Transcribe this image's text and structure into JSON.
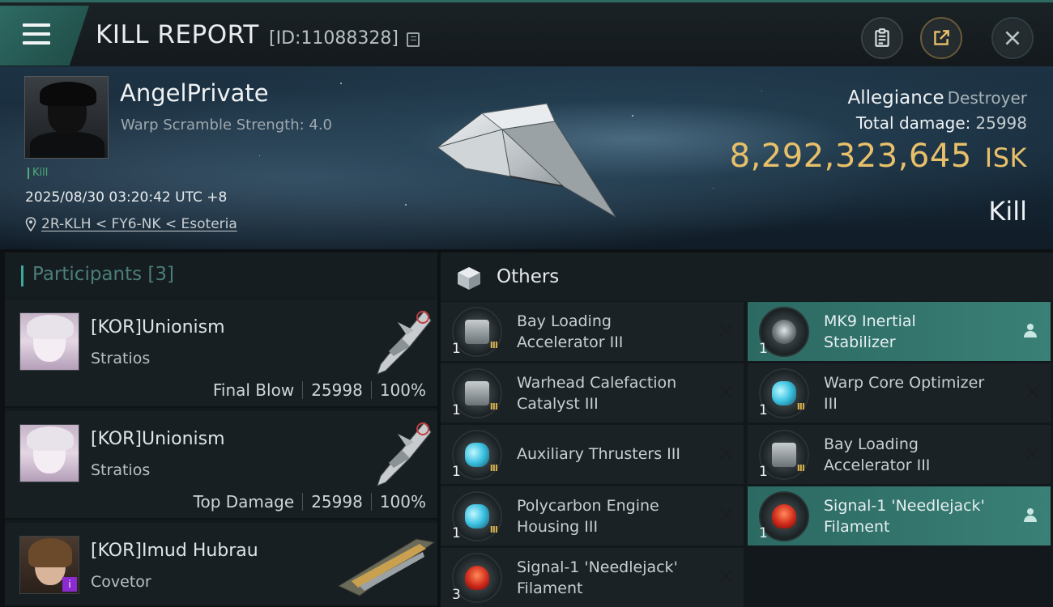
{
  "header": {
    "title": "KILL REPORT",
    "report_id": "[ID:11088328]"
  },
  "victim": {
    "name": "AngelPrivate",
    "warp_scramble": "Warp Scramble Strength: 4.0",
    "kill_tag": "Kill",
    "datetime": "2025/08/30 03:20:42 UTC +8",
    "location": "2R-KLH < FY6-NK < Esoteria",
    "allegiance_label": "Allegiance",
    "ship_class": "Destroyer",
    "total_damage_label": "Total damage:",
    "total_damage": "25998",
    "isk_value": "8,292,323,645",
    "isk_unit": "ISK",
    "result": "Kill"
  },
  "participants": {
    "title": "Participants",
    "count": "[3]",
    "rows": [
      {
        "name": "[KOR]Unionism",
        "ship": "Stratios",
        "role": "Final Blow",
        "damage": "25998",
        "percent": "100%"
      },
      {
        "name": "[KOR]Unionism",
        "ship": "Stratios",
        "role": "Top Damage",
        "damage": "25998",
        "percent": "100%"
      },
      {
        "name": "[KOR]Imud Hubrau",
        "ship": "Covetor",
        "badge": "i"
      }
    ]
  },
  "others": {
    "title": "Others",
    "left_items": [
      {
        "line1": "Bay Loading",
        "line2": "Accelerator III",
        "qty": "1",
        "icon": "gray",
        "tier": "III"
      },
      {
        "line1": "Warhead Calefaction",
        "line2": "Catalyst III",
        "qty": "1",
        "icon": "gray",
        "tier": "III"
      },
      {
        "line1": "Auxiliary Thrusters III",
        "line2": "",
        "qty": "1",
        "icon": "blue",
        "tier": "III"
      },
      {
        "line1": "Polycarbon Engine",
        "line2": "Housing III",
        "qty": "1",
        "icon": "blue",
        "tier": "III"
      },
      {
        "line1": "Signal-1 'Needlejack'",
        "line2": "Filament",
        "qty": "3",
        "icon": "red",
        "tier": ""
      }
    ],
    "right_items": [
      {
        "line1": "MK9 Inertial",
        "line2": "Stabilizer",
        "qty": "1",
        "icon": "orb",
        "tier": "",
        "highlight": true
      },
      {
        "line1": "Warp Core Optimizer",
        "line2": "III",
        "qty": "1",
        "icon": "blue",
        "tier": "III",
        "highlight": false
      },
      {
        "line1": "Bay Loading",
        "line2": "Accelerator III",
        "qty": "1",
        "icon": "gray",
        "tier": "III",
        "highlight": false
      },
      {
        "line1": "Signal-1 'Needlejack'",
        "line2": "Filament",
        "qty": "1",
        "icon": "red",
        "tier": "",
        "highlight": true
      }
    ]
  },
  "colors": {
    "accent": "#2e6a63",
    "isk_gold": "#e8c06a",
    "highlight_teal": "#3a8076"
  }
}
